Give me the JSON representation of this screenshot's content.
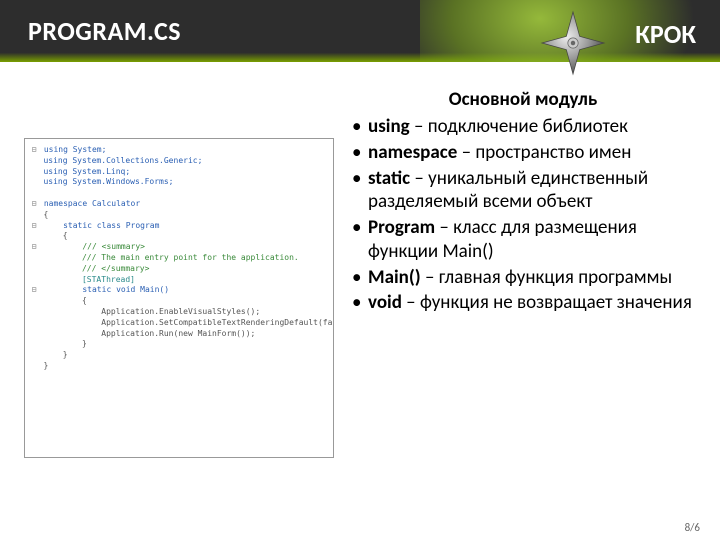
{
  "header": {
    "title": "PROGRAM.CS",
    "brand": "КРОК"
  },
  "subtitle": "Основной модуль",
  "bullets": [
    {
      "term": "using",
      "desc": " – подключение библиотек"
    },
    {
      "term": "namespace",
      "desc": " – пространство имен"
    },
    {
      "term": "static",
      "desc": " – уникальный единственный разделяемый всеми объект"
    },
    {
      "term": "Program",
      "desc": " – класс для размещения функции Main()"
    },
    {
      "term": "Main()",
      "desc": " – главная функция программы"
    },
    {
      "term": "void",
      "desc": " – функция не возвращает значения"
    }
  ],
  "code": {
    "l1": "using System;",
    "l2": "using System.Collections.Generic;",
    "l3": "using System.Linq;",
    "l4": "using System.Windows.Forms;",
    "l5": "namespace Calculator",
    "l6": "{",
    "l7": "    static class Program",
    "l8": "    {",
    "l9": "        /// <summary>",
    "l10": "        /// The main entry point for the application.",
    "l11": "        /// </summary>",
    "l12": "        [STAThread]",
    "l13": "        static void Main()",
    "l14": "        {",
    "l15": "            Application.EnableVisualStyles();",
    "l16": "            Application.SetCompatibleTextRenderingDefault(false);",
    "l17": "            Application.Run(new MainForm());",
    "l18": "        }",
    "l19": "    }",
    "l20": "}"
  },
  "pager": "8/6"
}
